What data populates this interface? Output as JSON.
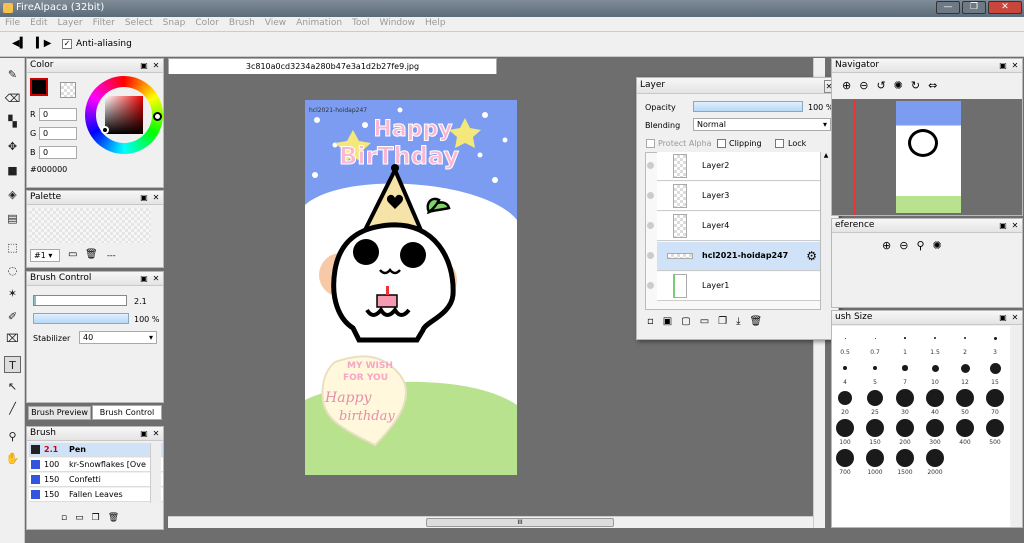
{
  "window": {
    "title": "FireAlpaca (32bit)",
    "min": "—",
    "max": "❐",
    "close": "✕"
  },
  "menu": [
    "File",
    "Edit",
    "Layer",
    "Filter",
    "Select",
    "Snap",
    "Color",
    "Brush",
    "View",
    "Animation",
    "Tool",
    "Window",
    "Help"
  ],
  "toolbar": {
    "anti_aliasing": "Anti-aliasing"
  },
  "document_tab": "3c810a0cd3234a280b47e3a1d2b27fe9.jpg",
  "color_panel": {
    "title": "Color",
    "r_label": "R",
    "g_label": "G",
    "b_label": "B",
    "r": "0",
    "g": "0",
    "b": "0",
    "hex": "#000000"
  },
  "palette_panel": {
    "title": "Palette",
    "selector": "#1",
    "dash": "---"
  },
  "brush_control": {
    "title": "Brush Control",
    "size": "2.1",
    "opacity": "100 %",
    "stabilizer_label": "Stabilizer",
    "stabilizer": "40"
  },
  "brush_tabs": {
    "preview": "Brush Preview",
    "control": "Brush Control"
  },
  "brush_panel": {
    "title": "Brush",
    "items": [
      {
        "size": "2.1",
        "name": "Pen",
        "color": "#222222"
      },
      {
        "size": "100",
        "name": "kr-Snowflakes [Ove",
        "color": "#3355dd"
      },
      {
        "size": "150",
        "name": "Confetti",
        "color": "#3355dd"
      },
      {
        "size": "150",
        "name": "Fallen Leaves",
        "color": "#3355dd"
      }
    ]
  },
  "layer_panel": {
    "title": "Layer",
    "opacity_label": "Opacity",
    "opacity": "100 %",
    "blending_label": "Blending",
    "blending": "Normal",
    "protect_alpha": "Protect Alpha",
    "clipping": "Clipping",
    "lock": "Lock",
    "layers": [
      "Layer2",
      "Layer3",
      "Layer4",
      "hcl2021-hoidap247",
      "Layer1"
    ]
  },
  "navigator": {
    "title": "Navigator"
  },
  "reference": {
    "title": "eference"
  },
  "brush_size": {
    "title": "ush Size",
    "labels": [
      "0.5",
      "0.7",
      "1",
      "1.5",
      "2",
      "3",
      "4",
      "5",
      "7",
      "10",
      "12",
      "15",
      "20",
      "25",
      "30",
      "40",
      "50",
      "70",
      "100",
      "150",
      "200",
      "300",
      "400",
      "500",
      "700",
      "1000",
      "1500",
      "2000"
    ]
  },
  "artwork": {
    "line1": "Happy",
    "line2": "BirThday",
    "wish1": "MY WISH",
    "wish2": "FOR YOU",
    "script1": "Happy",
    "script2": "birthday",
    "watermark": "hcl2021-hoidap247"
  }
}
